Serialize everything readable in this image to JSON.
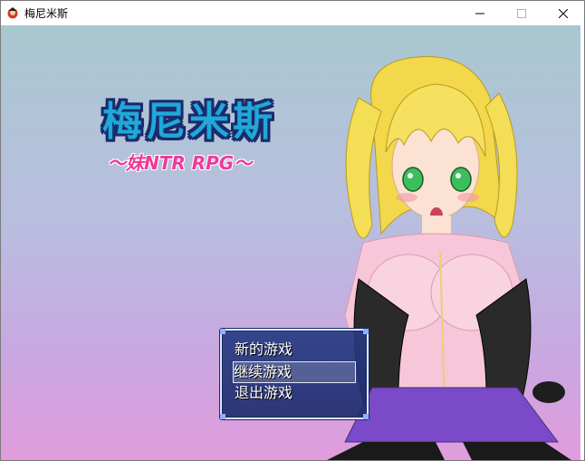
{
  "window": {
    "title": "梅尼米斯",
    "controls": [
      "minimize",
      "maximize",
      "close"
    ]
  },
  "game": {
    "logo_title": "梅尼米斯",
    "logo_subtitle": "〜妹NTR RPG〜",
    "menu": {
      "items": [
        {
          "label": "新的游戏",
          "selected": false
        },
        {
          "label": "继续游戏",
          "selected": true
        },
        {
          "label": "退出游戏",
          "selected": false
        }
      ]
    }
  },
  "colors": {
    "title_blue": "#20a8d8",
    "title_outline": "#1a2b6b",
    "subtitle_pink": "#f03a9a",
    "menu_bg": "#283c82"
  }
}
